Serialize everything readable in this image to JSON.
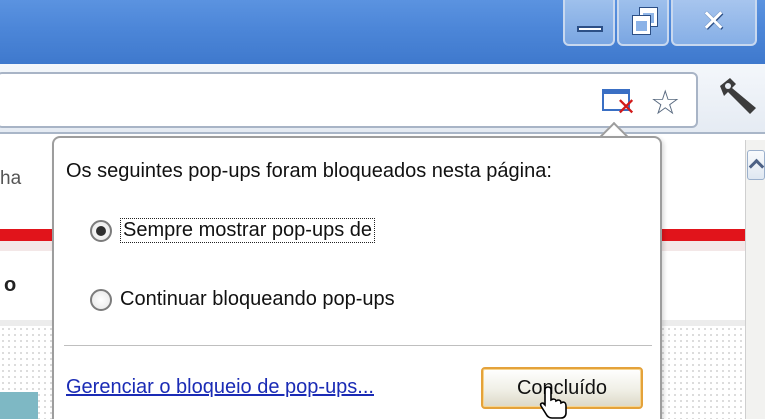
{
  "window": {
    "controls": {
      "minimize_icon": "minimize-icon",
      "restore_icon": "restore-icon",
      "close_icon": "close-icon"
    },
    "titlebar_color": "#4c86d8"
  },
  "toolbar": {
    "popup_blocked_icon": "popup-blocked-icon",
    "bookmark_icon": "star-icon",
    "menu_icon": "wrench-icon"
  },
  "page": {
    "partial_text": "ha",
    "partial_bold": "o",
    "accent_color": "#e1141b"
  },
  "bubble": {
    "title": "Os seguintes pop-ups foram bloqueados nesta página:",
    "options": [
      {
        "label": "Sempre mostrar pop-ups de",
        "selected": true
      },
      {
        "label": "Continuar bloqueando pop-ups",
        "selected": false
      }
    ],
    "manage_link": "Gerenciar o bloqueio de pop-ups...",
    "done_button": "Concluído",
    "button_border_color": "#e4a23a",
    "link_color": "#1a2bb5"
  }
}
